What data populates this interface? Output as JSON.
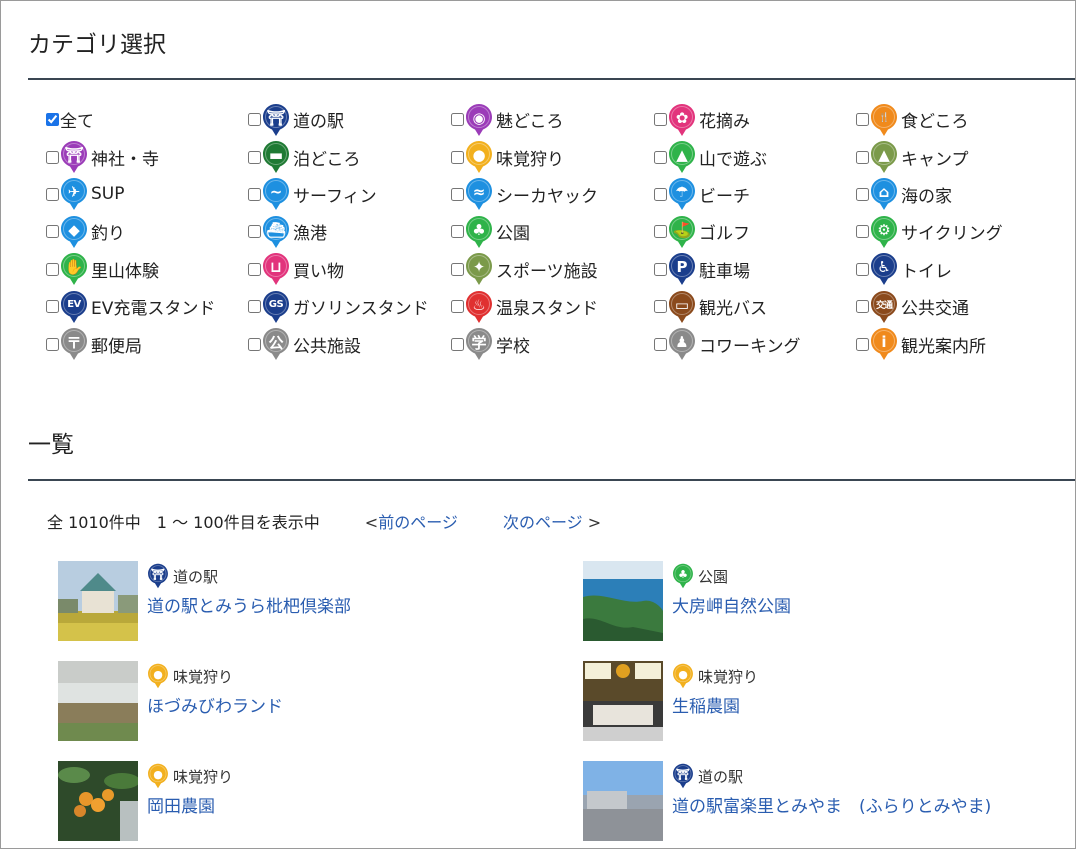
{
  "categories_title": "カテゴリ選択",
  "list_title": "一覧",
  "categories": [
    {
      "label": "全て",
      "checked": true,
      "icon": null,
      "color": null,
      "glyph": ""
    },
    {
      "label": "道の駅",
      "checked": false,
      "icon": "michinoeki-icon",
      "color": "#1b3e8c",
      "glyph": "⛩"
    },
    {
      "label": "魅どころ",
      "checked": false,
      "icon": "eye-icon",
      "color": "#9b3cb8",
      "glyph": "◉"
    },
    {
      "label": "花摘み",
      "checked": false,
      "icon": "flower-icon",
      "color": "#e2347c",
      "glyph": "✿"
    },
    {
      "label": "食どころ",
      "checked": false,
      "icon": "fork-knife-icon",
      "color": "#f08a1c",
      "glyph": "🍴"
    },
    {
      "label": "神社・寺",
      "checked": false,
      "icon": "shrine-icon",
      "color": "#9b3cb8",
      "glyph": "⛩"
    },
    {
      "label": "泊どころ",
      "checked": false,
      "icon": "bed-icon",
      "color": "#1f7a34",
      "glyph": "▬"
    },
    {
      "label": "味覚狩り",
      "checked": false,
      "icon": "fruit-icon",
      "color": "#f2b01e",
      "glyph": "●"
    },
    {
      "label": "山で遊ぶ",
      "checked": false,
      "icon": "mountain-icon",
      "color": "#2fb34a",
      "glyph": "▲"
    },
    {
      "label": "キャンプ",
      "checked": false,
      "icon": "tent-icon",
      "color": "#7b9a4a",
      "glyph": "▲"
    },
    {
      "label": "SUP",
      "checked": false,
      "icon": "sup-icon",
      "color": "#1e90e0",
      "glyph": "✈"
    },
    {
      "label": "サーフィン",
      "checked": false,
      "icon": "surfing-icon",
      "color": "#1e90e0",
      "glyph": "~"
    },
    {
      "label": "シーカヤック",
      "checked": false,
      "icon": "kayak-icon",
      "color": "#1e90e0",
      "glyph": "≈"
    },
    {
      "label": "ビーチ",
      "checked": false,
      "icon": "beach-umbrella-icon",
      "color": "#1e90e0",
      "glyph": "☂"
    },
    {
      "label": "海の家",
      "checked": false,
      "icon": "house-icon",
      "color": "#1e90e0",
      "glyph": "⌂"
    },
    {
      "label": "釣り",
      "checked": false,
      "icon": "fish-icon",
      "color": "#1e90e0",
      "glyph": "◆"
    },
    {
      "label": "漁港",
      "checked": false,
      "icon": "ship-icon",
      "color": "#1e90e0",
      "glyph": "⛴"
    },
    {
      "label": "公園",
      "checked": false,
      "icon": "tree-icon",
      "color": "#2fb34a",
      "glyph": "♣"
    },
    {
      "label": "ゴルフ",
      "checked": false,
      "icon": "golf-icon",
      "color": "#2fb34a",
      "glyph": "⛳"
    },
    {
      "label": "サイクリング",
      "checked": false,
      "icon": "bicycle-icon",
      "color": "#2fb34a",
      "glyph": "⚙"
    },
    {
      "label": "里山体験",
      "checked": false,
      "icon": "satoyama-icon",
      "color": "#2fb34a",
      "glyph": "✋"
    },
    {
      "label": "買い物",
      "checked": false,
      "icon": "basket-icon",
      "color": "#e2347c",
      "glyph": "⊔"
    },
    {
      "label": "スポーツ施設",
      "checked": false,
      "icon": "sports-icon",
      "color": "#7b9a4a",
      "glyph": "✦"
    },
    {
      "label": "駐車場",
      "checked": false,
      "icon": "parking-icon",
      "color": "#1b3e8c",
      "glyph": "P"
    },
    {
      "label": "トイレ",
      "checked": false,
      "icon": "toilet-icon",
      "color": "#1b3e8c",
      "glyph": "♿"
    },
    {
      "label": "EV充電スタンド",
      "checked": false,
      "icon": "ev-charge-icon",
      "color": "#1b3e8c",
      "glyph": "EV"
    },
    {
      "label": "ガソリンスタンド",
      "checked": false,
      "icon": "gas-station-icon",
      "color": "#1b3e8c",
      "glyph": "GS"
    },
    {
      "label": "温泉スタンド",
      "checked": false,
      "icon": "hot-spring-icon",
      "color": "#e03030",
      "glyph": "♨"
    },
    {
      "label": "観光バス",
      "checked": false,
      "icon": "bus-icon",
      "color": "#8b4a1c",
      "glyph": "▭"
    },
    {
      "label": "公共交通",
      "checked": false,
      "icon": "public-transport-icon",
      "color": "#8b4a1c",
      "glyph": "交通"
    },
    {
      "label": "郵便局",
      "checked": false,
      "icon": "post-office-icon",
      "color": "#8a8a8a",
      "glyph": "〒"
    },
    {
      "label": "公共施設",
      "checked": false,
      "icon": "public-facility-icon",
      "color": "#8a8a8a",
      "glyph": "公"
    },
    {
      "label": "学校",
      "checked": false,
      "icon": "school-icon",
      "color": "#8a8a8a",
      "glyph": "学"
    },
    {
      "label": "コワーキング",
      "checked": false,
      "icon": "coworking-icon",
      "color": "#8a8a8a",
      "glyph": "♟"
    },
    {
      "label": "観光案内所",
      "checked": false,
      "icon": "info-icon",
      "color": "#f08a1c",
      "glyph": "i"
    }
  ],
  "paging": {
    "count_text": "全 1010件中　1 〜 100件目を表示中",
    "prev_symbol": "<",
    "prev_label": "前のページ",
    "next_label": "次のページ",
    "next_symbol": ">"
  },
  "entries": [
    {
      "category": "道の駅",
      "category_icon": "michinoeki-icon",
      "category_color": "#1b3e8c",
      "glyph": "⛩",
      "title": "道の駅とみうら枇杷倶楽部",
      "thumb": "building-field"
    },
    {
      "category": "公園",
      "category_icon": "tree-icon",
      "category_color": "#2fb34a",
      "glyph": "♣",
      "title": "大房岬自然公園",
      "thumb": "coast-aerial"
    },
    {
      "category": "味覚狩り",
      "category_icon": "fruit-icon",
      "category_color": "#f2b01e",
      "glyph": "●",
      "title": "ほづみびわランド",
      "thumb": "greenhouse"
    },
    {
      "category": "味覚狩り",
      "category_icon": "fruit-icon",
      "category_color": "#f2b01e",
      "glyph": "●",
      "title": "生稲農園",
      "thumb": "shop-front"
    },
    {
      "category": "味覚狩り",
      "category_icon": "fruit-icon",
      "category_color": "#f2b01e",
      "glyph": "●",
      "title": "岡田農園",
      "thumb": "loquat"
    },
    {
      "category": "道の駅",
      "category_icon": "michinoeki-icon",
      "category_color": "#1b3e8c",
      "glyph": "⛩",
      "title": "道の駅富楽里とみやま　(ふらりとみやま)",
      "thumb": "parking-building"
    }
  ]
}
